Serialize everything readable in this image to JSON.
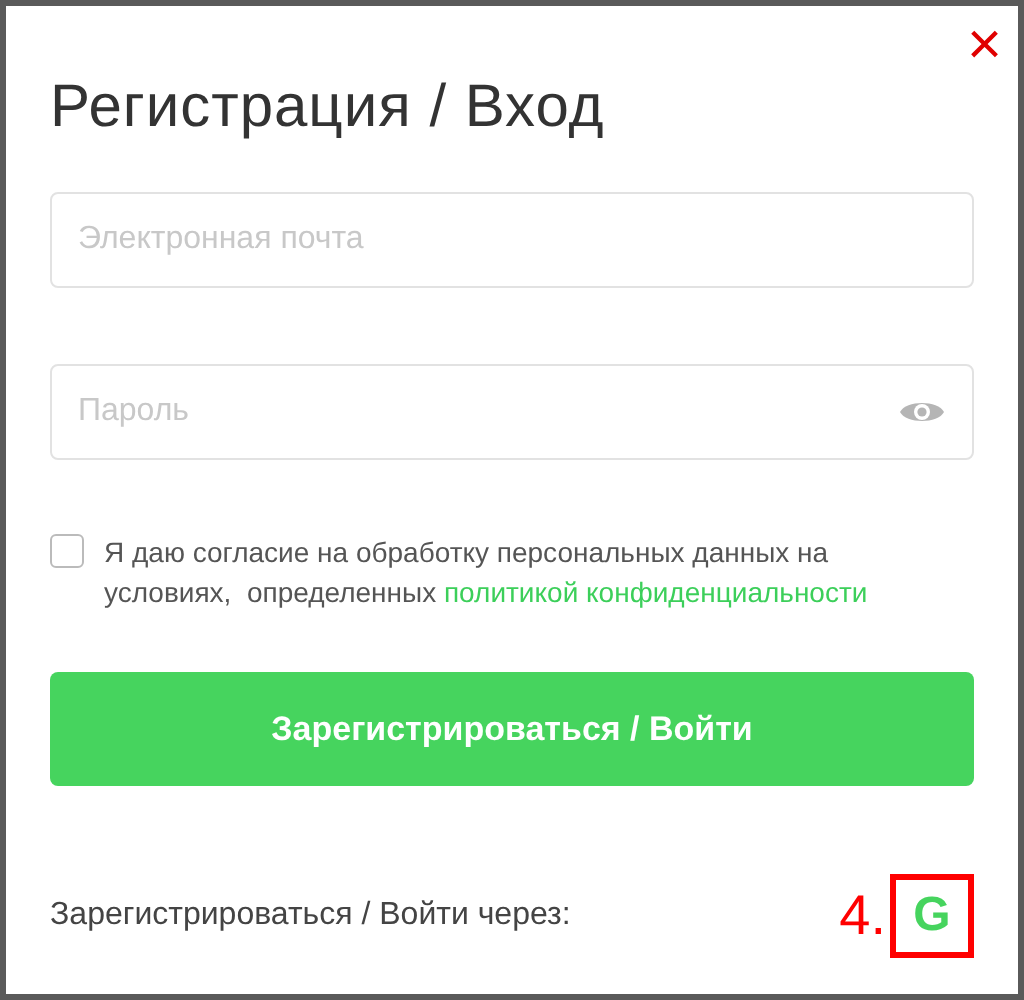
{
  "dialog": {
    "title": "Регистрация / Вход",
    "close": "×"
  },
  "email": {
    "placeholder": "Электронная почта"
  },
  "password": {
    "placeholder": "Пароль"
  },
  "consent": {
    "checked": false,
    "text": "Я даю согласие на обработку персональных данных на условиях,  определенных",
    "link": "политикой конфиденциальности"
  },
  "submit": "Зарегистрироваться / Войти",
  "social": {
    "label": "Зарегистрироваться / Войти через:",
    "providers": [
      {
        "letter": "G"
      }
    ]
  },
  "annotation": {
    "text": "4."
  }
}
